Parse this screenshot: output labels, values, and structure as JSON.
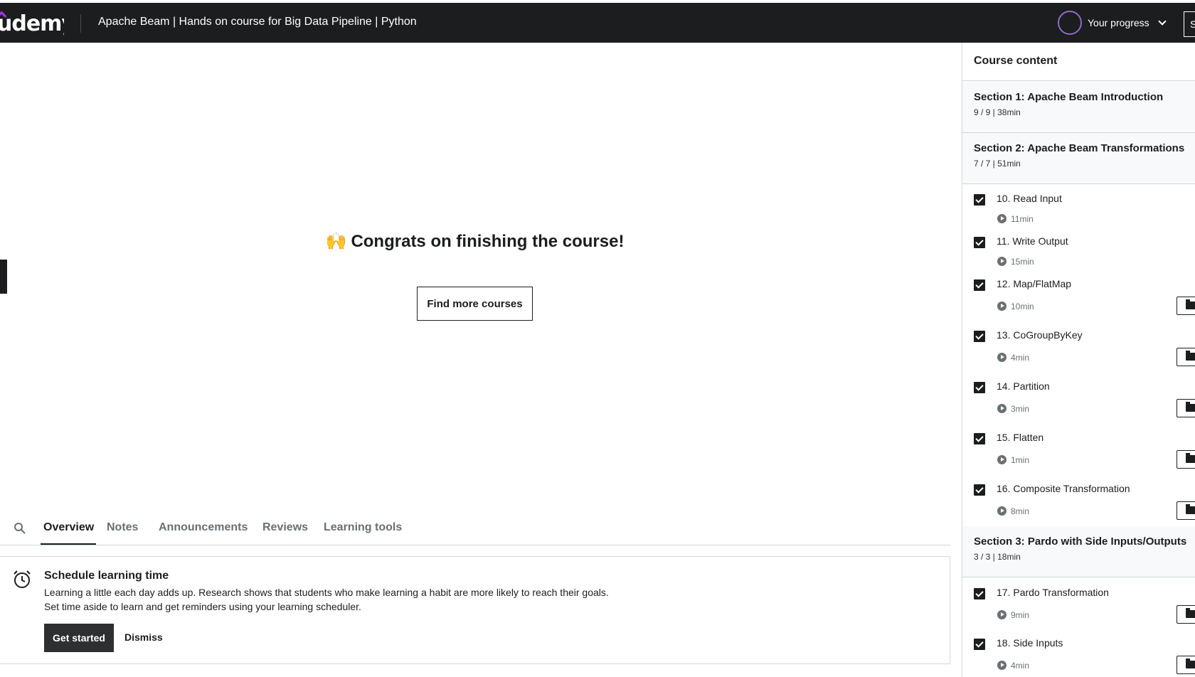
{
  "header": {
    "logo": "udemy",
    "course_title": "Apache Beam | Hands on course for Big Data Pipeline | Python",
    "progress_label": "Your progress",
    "share_label": "S"
  },
  "main": {
    "congrats_emoji": "🙌",
    "congrats_text": "Congrats on finishing the course!",
    "find_more_label": "Find more courses"
  },
  "tabs": [
    "Overview",
    "Notes",
    "Announcements",
    "Reviews",
    "Learning tools"
  ],
  "schedule_card": {
    "title": "Schedule learning time",
    "text_line1": "Learning a little each day adds up. Research shows that students who make learning a habit are more likely to reach their goals.",
    "text_line2": "Set time aside to learn and get reminders using your learning scheduler.",
    "get_started_label": "Get started",
    "dismiss_label": "Dismiss"
  },
  "sidebar": {
    "title": "Course content",
    "sections": [
      {
        "title": "Section 1: Apache Beam Introduction",
        "meta": "9 / 9 | 38min"
      },
      {
        "title": "Section 2: Apache Beam Transformations",
        "meta": "7 / 7 | 51min"
      },
      {
        "title": "Section 3: Pardo with Side Inputs/Outputs",
        "meta": "3 / 3 | 18min"
      }
    ],
    "lectures": [
      {
        "title": "10. Read Input",
        "duration": "11min",
        "completed": true,
        "resources": false
      },
      {
        "title": "11. Write Output",
        "duration": "15min",
        "completed": true,
        "resources": false
      },
      {
        "title": "12. Map/FlatMap",
        "duration": "10min",
        "completed": true,
        "resources": true
      },
      {
        "title": "13. CoGroupByKey",
        "duration": "4min",
        "completed": true,
        "resources": true
      },
      {
        "title": "14. Partition",
        "duration": "3min",
        "completed": true,
        "resources": true
      },
      {
        "title": "15. Flatten",
        "duration": "1min",
        "completed": true,
        "resources": true
      },
      {
        "title": "16. Composite Transformation",
        "duration": "8min",
        "completed": true,
        "resources": true
      },
      {
        "title": "17. Pardo Transformation",
        "duration": "9min",
        "completed": true,
        "resources": true
      },
      {
        "title": "18. Side Inputs",
        "duration": "4min",
        "completed": true,
        "resources": true
      }
    ]
  }
}
